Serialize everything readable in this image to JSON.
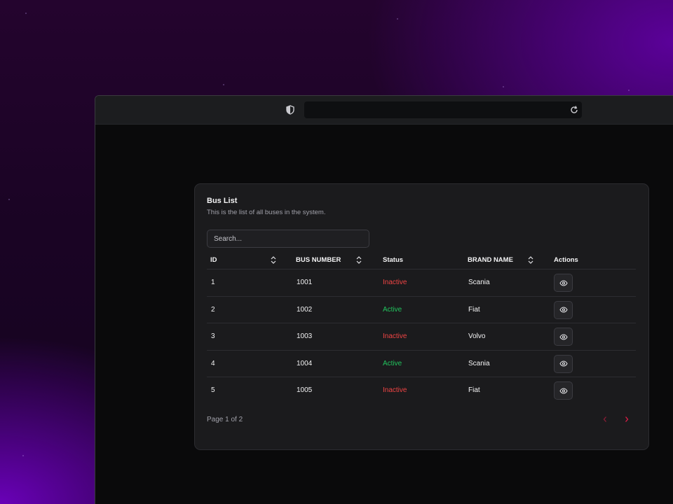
{
  "card": {
    "title": "Bus List",
    "subtitle": "This is the list of all buses in the system."
  },
  "search": {
    "placeholder": "Search...",
    "value": ""
  },
  "table": {
    "columns": [
      {
        "label": "ID",
        "sortable": true
      },
      {
        "label": "BUS NUMBER",
        "sortable": true
      },
      {
        "label": "Status",
        "sortable": false
      },
      {
        "label": "BRAND NAME",
        "sortable": true
      },
      {
        "label": "Actions",
        "sortable": false
      }
    ],
    "rows": [
      {
        "id": "1",
        "bus_number": "1001",
        "status": "Inactive",
        "brand": "Scania"
      },
      {
        "id": "2",
        "bus_number": "1002",
        "status": "Active",
        "brand": "Fiat"
      },
      {
        "id": "3",
        "bus_number": "1003",
        "status": "Inactive",
        "brand": "Volvo"
      },
      {
        "id": "4",
        "bus_number": "1004",
        "status": "Active",
        "brand": "Scania"
      },
      {
        "id": "5",
        "bus_number": "1005",
        "status": "Inactive",
        "brand": "Fiat"
      }
    ],
    "row_action_icon": "eye-icon"
  },
  "pagination": {
    "label": "Page 1 of 2",
    "prev_icon": "chevron-left-icon",
    "next_icon": "chevron-right-icon"
  },
  "colors": {
    "inactive": "#ef4444",
    "active": "#22c55e",
    "pager_accent": "#e11d48",
    "card_bg": "#1b1b1d"
  }
}
